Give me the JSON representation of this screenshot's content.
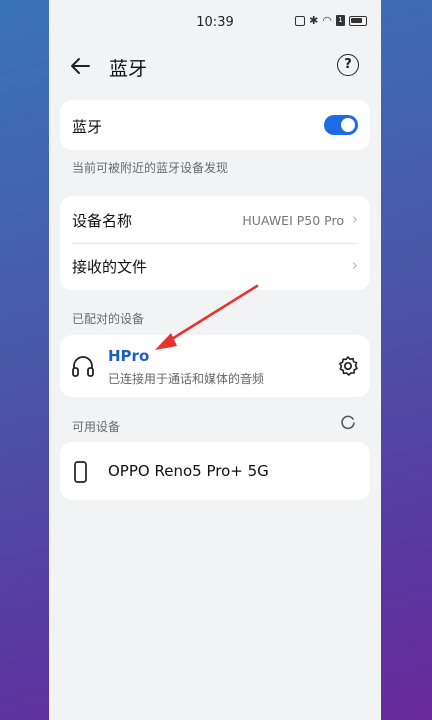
{
  "status": {
    "time": "10:39",
    "icons": [
      "nfc-icon",
      "bluetooth-icon",
      "wifi-icon",
      "sim-icon",
      "battery-icon"
    ]
  },
  "header": {
    "title": "蓝牙",
    "back_icon": "arrow-left-icon",
    "help_icon": "question-icon"
  },
  "bluetooth": {
    "label": "蓝牙",
    "enabled": true,
    "accent": "#1e6be6",
    "discoverable_caption": "当前可被附近的蓝牙设备发现"
  },
  "settings": {
    "device_name_label": "设备名称",
    "device_name_value": "HUAWEI P50 Pro",
    "received_files_label": "接收的文件"
  },
  "paired": {
    "section_label": "已配对的设备",
    "device": {
      "name": "HPro",
      "status": "已连接用于通话和媒体的音频",
      "icon": "headphones-icon"
    }
  },
  "available": {
    "section_label": "可用设备",
    "device": {
      "name": "OPPO Reno5 Pro+ 5G",
      "icon": "phone-icon"
    }
  },
  "colors": {
    "annotation_arrow": "#e8322d",
    "link_blue": "#1d5cc8"
  }
}
